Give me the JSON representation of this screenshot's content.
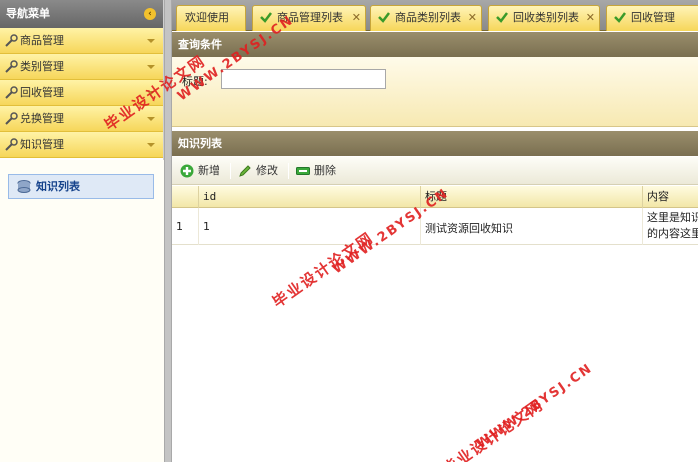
{
  "nav": {
    "title": "导航菜单",
    "items": [
      {
        "label": "商品管理"
      },
      {
        "label": "类别管理"
      },
      {
        "label": "回收管理"
      },
      {
        "label": "兑换管理"
      },
      {
        "label": "知识管理"
      }
    ],
    "active_link": "知识列表"
  },
  "tabs": [
    {
      "label": "欢迎使用",
      "closable": false
    },
    {
      "label": "商品管理列表",
      "closable": true
    },
    {
      "label": "商品类别列表",
      "closable": true
    },
    {
      "label": "回收类别列表",
      "closable": true
    },
    {
      "label": "回收管理",
      "closable": false
    }
  ],
  "search_panel": {
    "title": "查询条件",
    "field_label": "标题:",
    "field_value": ""
  },
  "grid_panel": {
    "title": "知识列表",
    "toolbar": {
      "add": "新增",
      "edit": "修改",
      "delete": "删除"
    },
    "columns": [
      "id",
      "标题",
      "内容"
    ],
    "rows": [
      {
        "rownum": "1",
        "id": "1",
        "title": "测试资源回收知识",
        "content_line1": "这里是知识",
        "content_line2": "的内容这里"
      }
    ]
  },
  "watermark": {
    "line_cn": "毕业设计论文网",
    "line_url": "WWW.2BYSJ.CN"
  },
  "colors": {
    "accent_yellow": "#f6d65a",
    "header_gray": "#7a6f50",
    "link_blue": "#15428b",
    "watermark_red": "#e02020"
  }
}
